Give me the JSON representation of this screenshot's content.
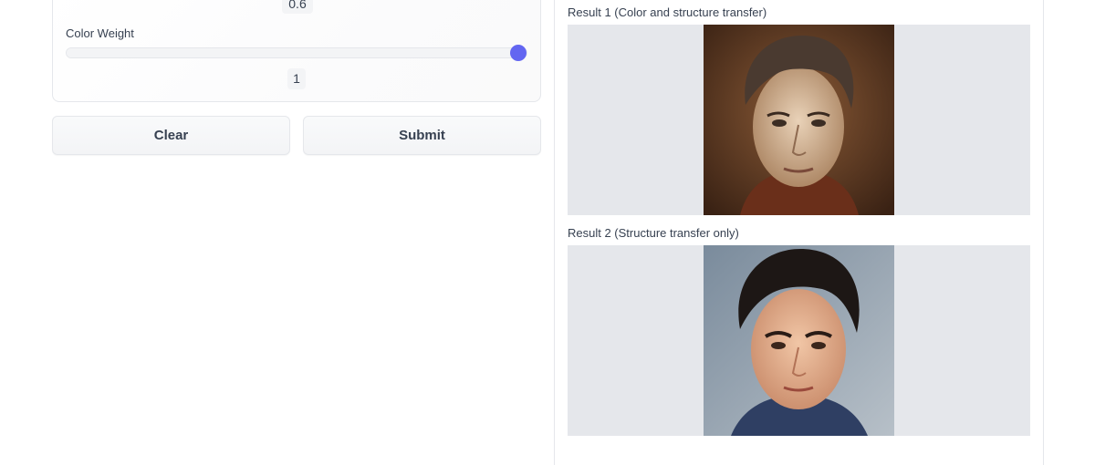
{
  "controls": {
    "prev_slider_value": "0.6",
    "color_weight": {
      "label": "Color Weight",
      "value": "1",
      "level_fraction": 1.0
    }
  },
  "actions": {
    "clear_label": "Clear",
    "submit_label": "Submit"
  },
  "results": [
    {
      "label": "Result 1 (Color and structure transfer)"
    },
    {
      "label": "Result 2 (Structure transfer only)"
    }
  ],
  "colors": {
    "accent": "#6366f1",
    "border": "#e5e7eb",
    "image_bg": "#e5e7eb"
  },
  "icons": {
    "slider_thumb": "slider-thumb-icon"
  }
}
